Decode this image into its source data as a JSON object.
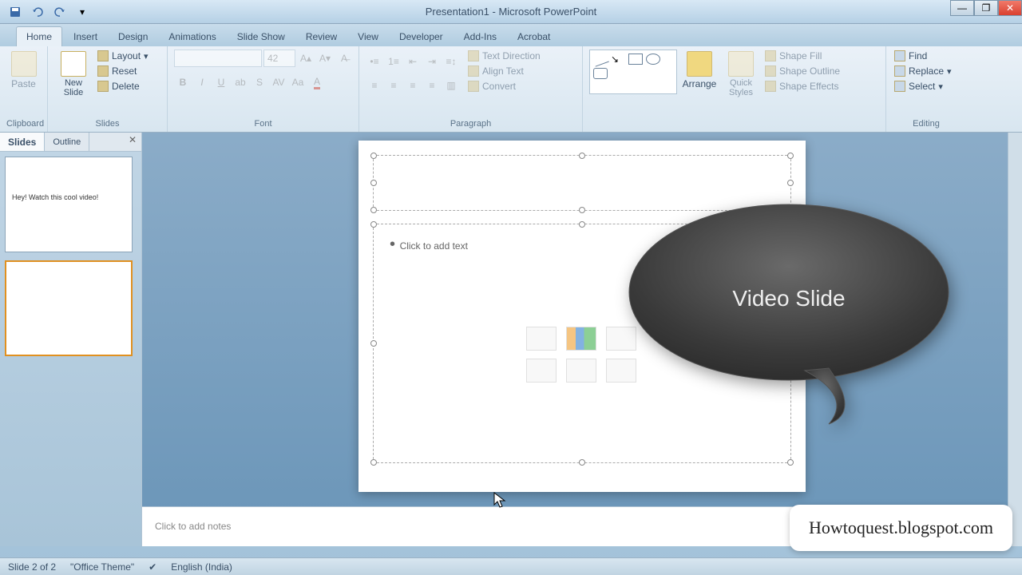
{
  "window": {
    "title": "Presentation1 - Microsoft PowerPoint"
  },
  "tabs": {
    "home": "Home",
    "insert": "Insert",
    "design": "Design",
    "animations": "Animations",
    "slideshow": "Slide Show",
    "review": "Review",
    "view": "View",
    "developer": "Developer",
    "addins": "Add-Ins",
    "acrobat": "Acrobat"
  },
  "ribbon": {
    "clipboard": {
      "label": "Clipboard",
      "paste": "Paste"
    },
    "slides": {
      "label": "Slides",
      "new_slide": "New\nSlide",
      "layout": "Layout",
      "reset": "Reset",
      "delete": "Delete"
    },
    "font": {
      "label": "Font",
      "size": "42"
    },
    "paragraph": {
      "label": "Paragraph",
      "text_direction": "Text Direction",
      "align_text": "Align Text",
      "convert": "Convert"
    },
    "drawing": {
      "arrange": "Arrange",
      "quick_styles": "Quick\nStyles",
      "shape_fill": "Shape Fill",
      "shape_outline": "Shape Outline",
      "shape_effects": "Shape Effects"
    },
    "editing": {
      "label": "Editing",
      "find": "Find",
      "replace": "Replace",
      "select": "Select"
    }
  },
  "sidepanel": {
    "slides_tab": "Slides",
    "outline_tab": "Outline",
    "thumb1_text": "Hey! Watch this cool video!"
  },
  "slide": {
    "content_placeholder": "Click to add text",
    "callout_text": "Video Slide"
  },
  "notes": {
    "placeholder": "Click to add notes"
  },
  "status": {
    "slide_info": "Slide 2 of 2",
    "theme": "\"Office Theme\"",
    "language": "English (India)"
  },
  "watermark": "Howtoquest.blogspot.com"
}
